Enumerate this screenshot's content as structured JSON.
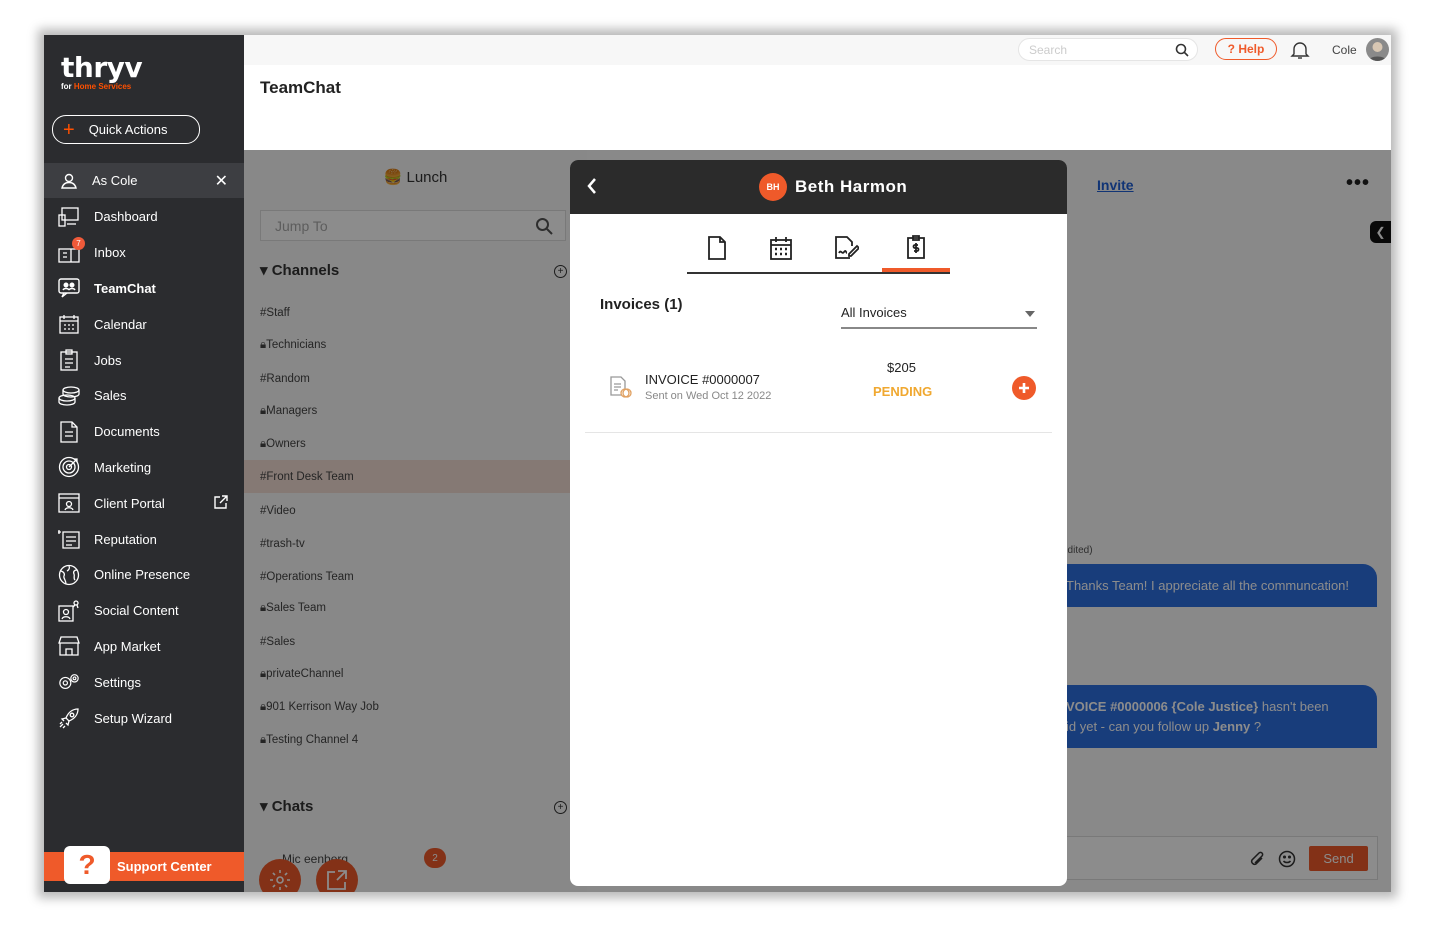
{
  "brand": {
    "logo": "thryv",
    "sub_prefix": "for ",
    "sub_accent": "Home Services",
    "accent_color": "#ef5a2a"
  },
  "sidebar": {
    "quick_actions": "Quick Actions",
    "as_user": "As Cole",
    "items": [
      {
        "label": "Dashboard",
        "icon": "dashboard-icon"
      },
      {
        "label": "Inbox",
        "icon": "inbox-icon",
        "badge": "7"
      },
      {
        "label": "TeamChat",
        "icon": "teamchat-icon",
        "active": true
      },
      {
        "label": "Calendar",
        "icon": "calendar-icon"
      },
      {
        "label": "Jobs",
        "icon": "jobs-icon"
      },
      {
        "label": "Sales",
        "icon": "sales-icon"
      },
      {
        "label": "Documents",
        "icon": "documents-icon"
      },
      {
        "label": "Marketing",
        "icon": "marketing-icon"
      },
      {
        "label": "Client Portal",
        "icon": "client-portal-icon"
      },
      {
        "label": "Reputation",
        "icon": "reputation-icon"
      },
      {
        "label": "Online Presence",
        "icon": "globe-icon"
      },
      {
        "label": "Social Content",
        "icon": "social-icon"
      },
      {
        "label": "App Market",
        "icon": "store-icon"
      },
      {
        "label": "Settings",
        "icon": "gear-icon"
      },
      {
        "label": "Setup Wizard",
        "icon": "rocket-icon"
      }
    ],
    "support": "Support Center"
  },
  "topbar": {
    "search_placeholder": "Search",
    "help": "? Help",
    "user": "Cole"
  },
  "page": {
    "title": "TeamChat"
  },
  "channels": {
    "current": "🍔 Lunch",
    "jump_placeholder": "Jump To",
    "section_channels": "Channels",
    "list": [
      {
        "name": "#Staff",
        "locked": false
      },
      {
        "name": "Technicians",
        "locked": true
      },
      {
        "name": "#Random",
        "locked": false
      },
      {
        "name": "Managers",
        "locked": true
      },
      {
        "name": "Owners",
        "locked": true
      },
      {
        "name": "#Front Desk Team",
        "locked": false,
        "active": true
      },
      {
        "name": "#Video",
        "locked": false
      },
      {
        "name": "#trash-tv",
        "locked": false
      },
      {
        "name": "#Operations Team",
        "locked": false
      },
      {
        "name": "Sales Team",
        "locked": true
      },
      {
        "name": "#Sales",
        "locked": false
      },
      {
        "name": "privateChannel",
        "locked": true
      },
      {
        "name": "901 Kerrison Way Job",
        "locked": true
      },
      {
        "name": "Testing Channel 4",
        "locked": true
      }
    ],
    "section_chats": "Chats",
    "chat_name": "Mic      eenberg",
    "chat_badge": "2"
  },
  "chat": {
    "invite": "Invite",
    "more": "•••",
    "meta": "edited)",
    "msg1": "Thanks Team! I appreciate all the communcation!",
    "msg2_bold": "VOICE #0000006 {Cole Justice}",
    "msg2_rest": " hasn't been",
    "msg2_line2": "id yet - can you follow up ",
    "msg2_mention": "Jenny",
    "msg2_end": " ?",
    "send": "Send"
  },
  "modal": {
    "initials": "BH",
    "name": "Beth Harmon",
    "tabs": [
      "document-icon",
      "calendar-icon",
      "signature-icon",
      "invoice-icon"
    ],
    "active_tab": 3,
    "invoices_title": "Invoices (1)",
    "filter": "All Invoices",
    "invoice": {
      "number": "INVOICE #0000007",
      "sent": "Sent on Wed Oct 12 2022",
      "amount": "$205",
      "status": "PENDING"
    }
  }
}
